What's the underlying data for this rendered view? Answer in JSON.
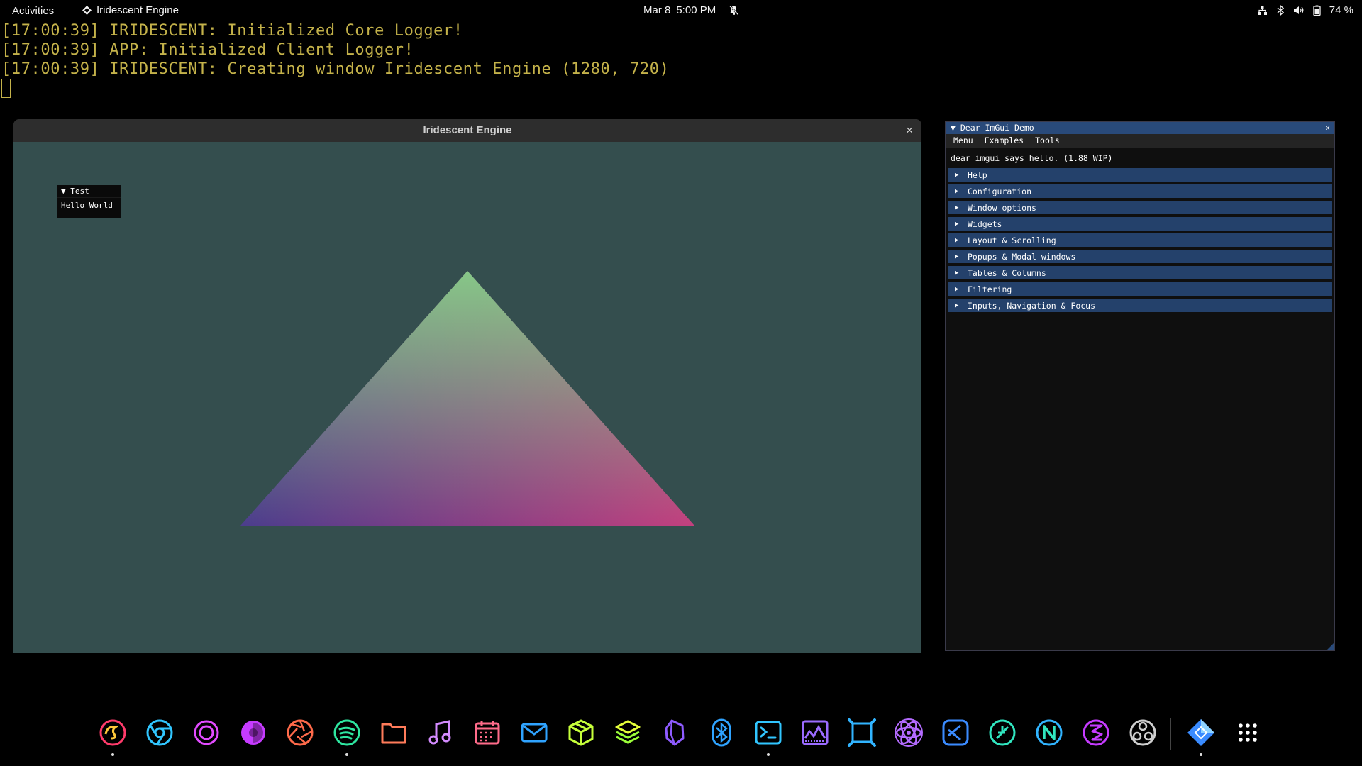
{
  "topbar": {
    "activities_label": "Activities",
    "app_menu_label": "Iridescent Engine",
    "date": "Mar 8",
    "time": "5:00 PM",
    "battery": "74 %"
  },
  "terminal": {
    "lines": [
      "[17:00:39] IRIDESCENT: Initialized Core Logger!",
      "[17:00:39] APP: Initialized Client Logger!",
      "[17:00:39] IRIDESCENT: Creating window Iridescent Engine (1280, 720)"
    ]
  },
  "engine_window": {
    "title": "Iridescent Engine",
    "close_glyph": "×",
    "test_window": {
      "title": "Test",
      "text": "Hello World"
    },
    "triangle_colors": {
      "top": "#86c787",
      "left": "#4b3d8c",
      "right": "#c2407e",
      "background": "#344e4e"
    }
  },
  "imgui_demo": {
    "title": "Dear ImGui Demo",
    "close_glyph": "×",
    "menu": [
      "Menu",
      "Examples",
      "Tools"
    ],
    "hello_text": "dear imgui says hello. (1.88 WIP)",
    "headers": [
      "Help",
      "Configuration",
      "Window options",
      "Widgets",
      "Layout & Scrolling",
      "Popups & Modal windows",
      "Tables & Columns",
      "Filtering",
      "Inputs, Navigation & Focus"
    ]
  },
  "dock": {
    "apps": [
      {
        "icon": "firefox-icon",
        "running": true,
        "color": "#ff3b6b"
      },
      {
        "icon": "chrome-icon",
        "running": false,
        "color": "#31c6ff"
      },
      {
        "icon": "browser-ring-icon",
        "running": false,
        "color": "#e24bff"
      },
      {
        "icon": "tor-browser-icon",
        "running": false,
        "color": "#c63bff"
      },
      {
        "icon": "camera-aperture-icon",
        "running": false,
        "color": "#ff6a4a"
      },
      {
        "icon": "spotify-icon",
        "running": true,
        "color": "#2ee6a0"
      },
      {
        "icon": "files-icon",
        "running": false,
        "color": "#ff7b5a"
      },
      {
        "icon": "music-icon",
        "running": false,
        "color": "#d48bff"
      },
      {
        "icon": "calendar-icon",
        "running": false,
        "color": "#ff6b8a"
      },
      {
        "icon": "mail-icon",
        "running": false,
        "color": "#2fa3ff"
      },
      {
        "icon": "package-box-icon",
        "running": false,
        "color": "#c6ff3a"
      },
      {
        "icon": "layers-icon",
        "running": false,
        "color": "#e4ff3a"
      },
      {
        "icon": "obsidian-icon",
        "running": false,
        "color": "#8e5bff"
      },
      {
        "icon": "bluetooth-icon",
        "running": false,
        "color": "#2fa3ff"
      },
      {
        "icon": "terminal-icon",
        "running": true,
        "color": "#31c6ff"
      },
      {
        "icon": "system-monitor-icon",
        "running": false,
        "color": "#9b6bff"
      },
      {
        "icon": "blender-frame-icon",
        "running": false,
        "color": "#31b4ff"
      },
      {
        "icon": "react-atom-icon",
        "running": false,
        "color": "#b46bff"
      },
      {
        "icon": "vscode-icon",
        "running": false,
        "color": "#3b8bff"
      },
      {
        "icon": "slash-circle-icon",
        "running": false,
        "color": "#31e6c0"
      },
      {
        "icon": "n-logo-icon",
        "running": false,
        "color": "#31b4ff"
      },
      {
        "icon": "emacs-icon",
        "running": false,
        "color": "#c63bff"
      },
      {
        "icon": "obs-icon",
        "running": false,
        "color": "#cfcfcf"
      },
      {
        "icon": "iridescent-engine-icon",
        "running": true,
        "color": "#3a8bff"
      },
      {
        "icon": "app-grid-icon",
        "running": false,
        "color": "#ffffff"
      }
    ]
  }
}
